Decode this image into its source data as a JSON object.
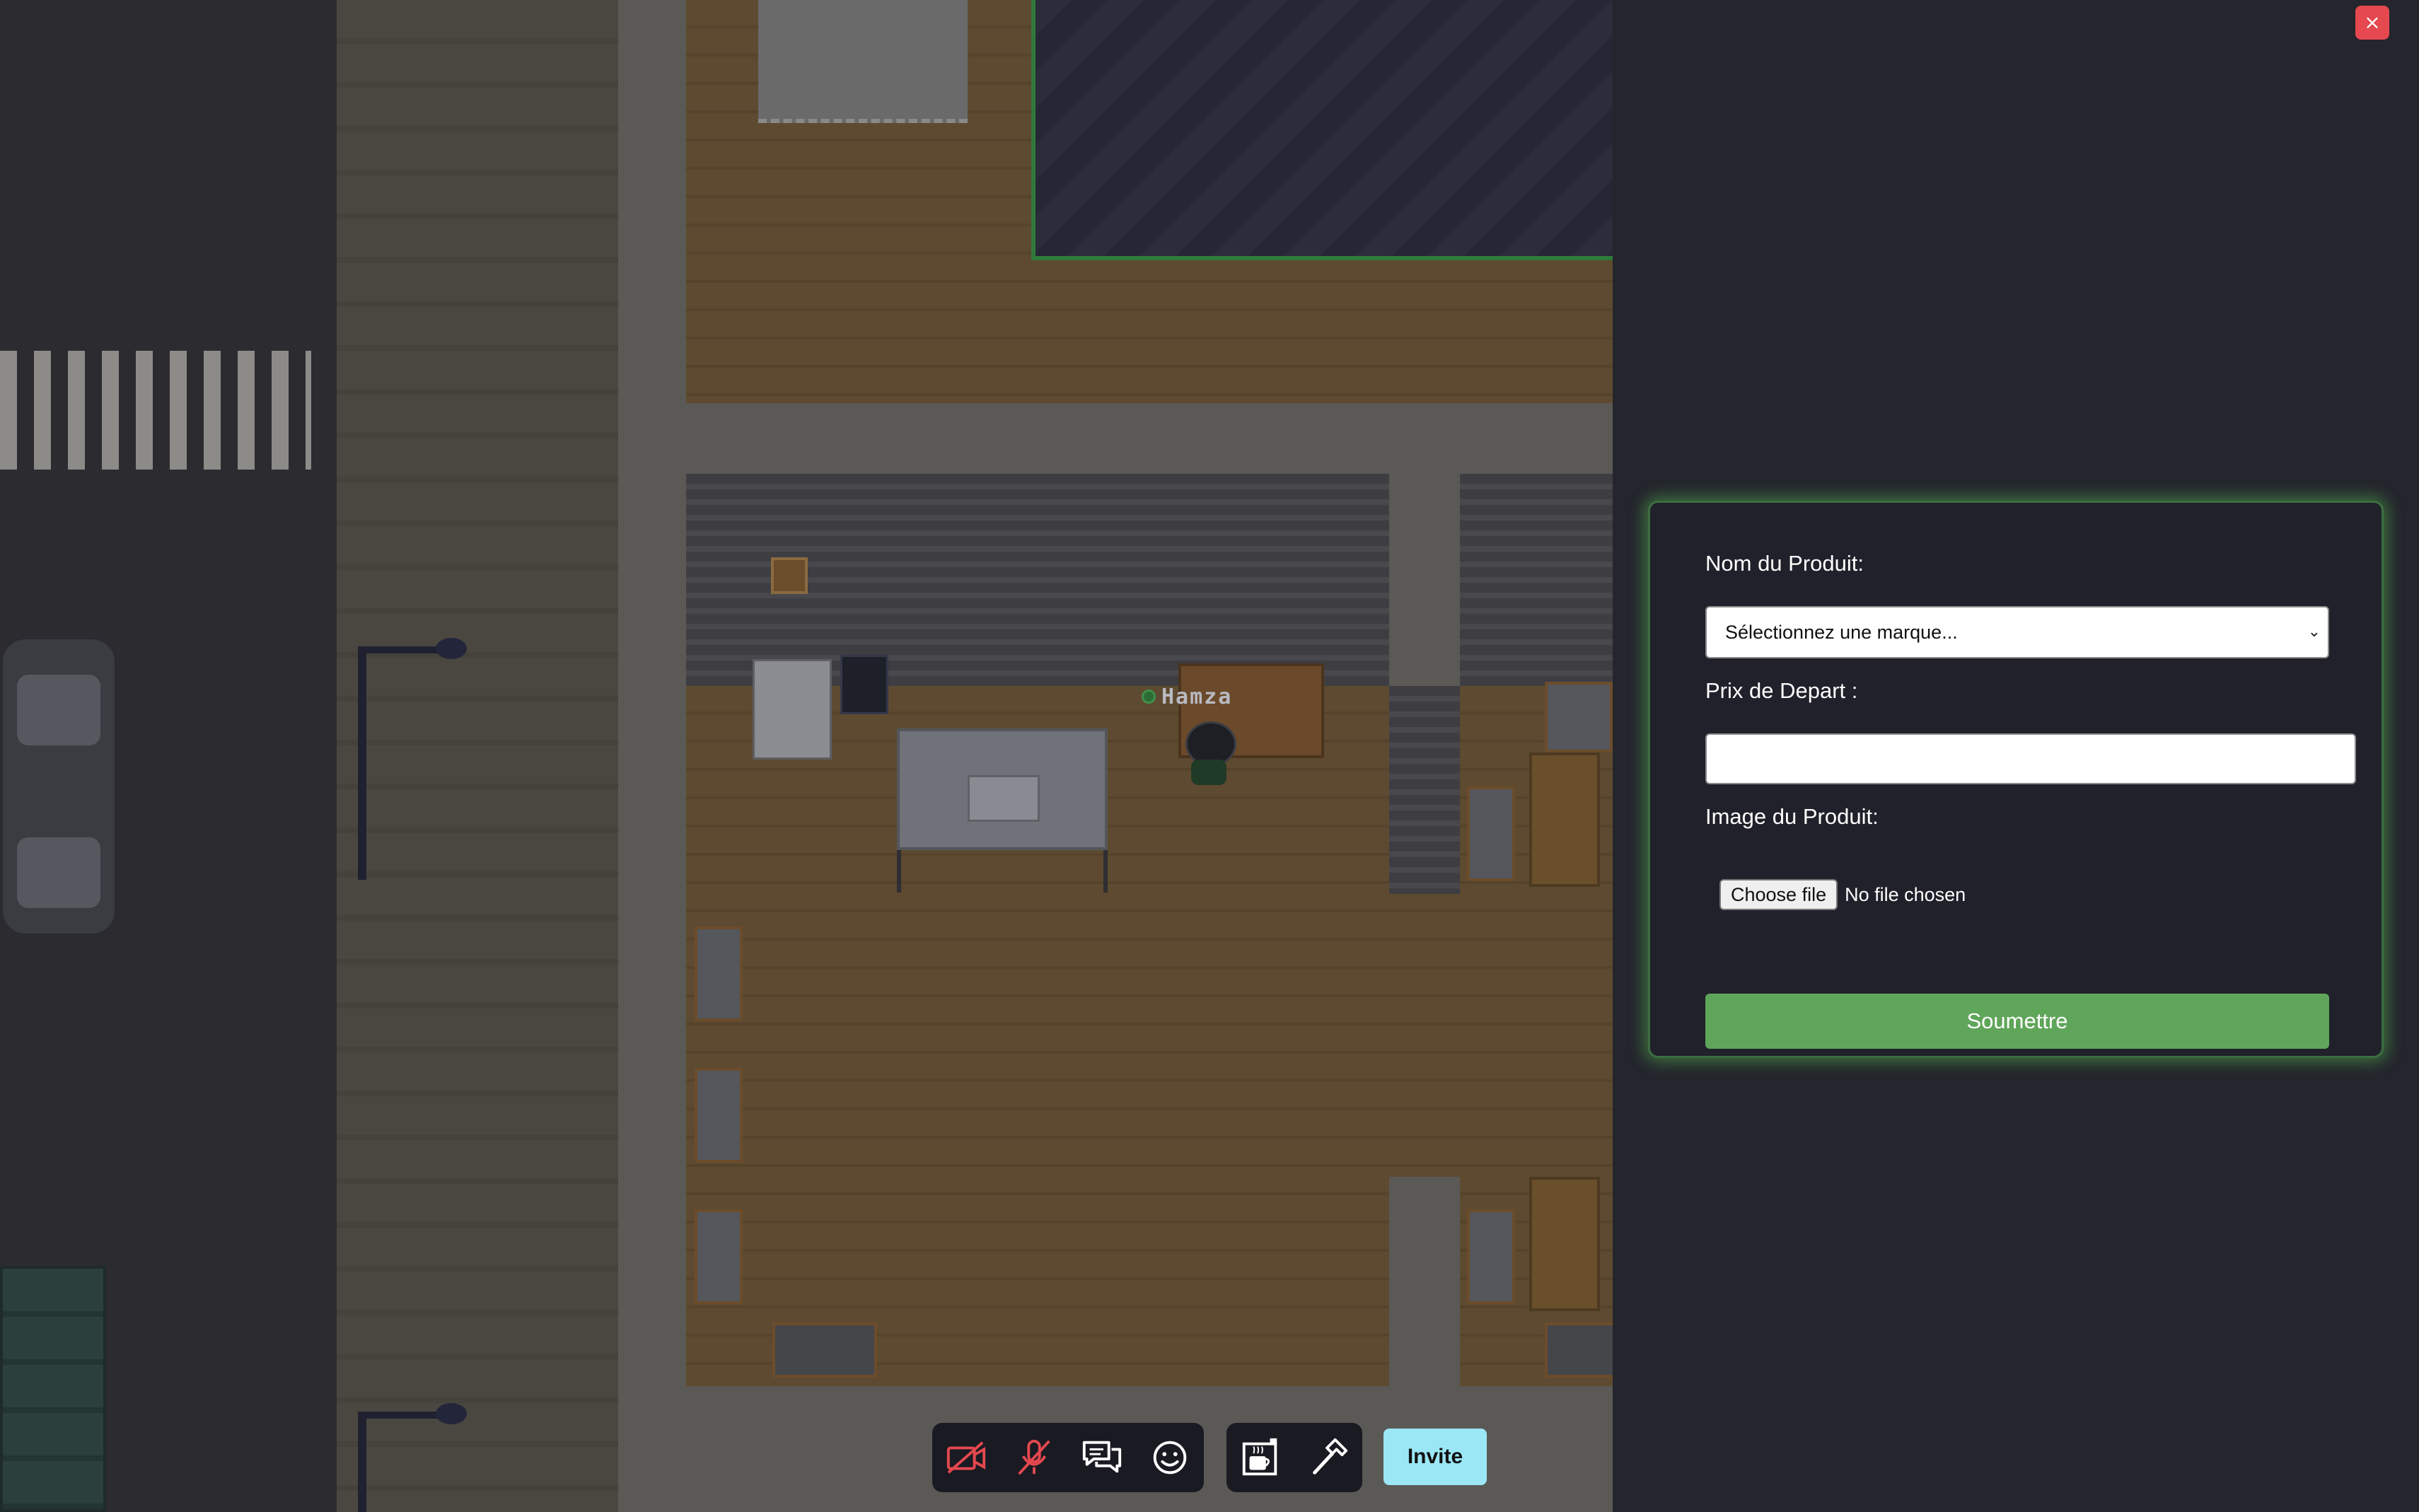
{
  "game_view": {
    "player_name": "Hamza",
    "player_status_color": "#3e8f49"
  },
  "modal": {
    "close_label": "×",
    "form": {
      "product_name_label": "Nom du Produit:",
      "brand_select_value": "Sélectionnez une marque...",
      "start_price_label": "Prix de Depart :",
      "start_price_value": "",
      "image_label": "Image du Produit:",
      "file_button_label": "Choose file",
      "file_status": "No file chosen",
      "submit_label": "Soumettre"
    },
    "accent_color": "#5fa55a"
  },
  "toolbar": {
    "media_controls": [
      {
        "icon": "camera-off-icon",
        "color": "#e5484f"
      },
      {
        "icon": "microphone-off-icon",
        "color": "#e5484f"
      },
      {
        "icon": "chat-bubbles-icon",
        "color": "#ffffff"
      },
      {
        "icon": "emoji-icon",
        "color": "#ffffff"
      }
    ],
    "tool_controls": [
      {
        "icon": "coffee-break-icon",
        "color": "#ffffff"
      },
      {
        "icon": "hammer-build-icon",
        "color": "#ffffff"
      }
    ],
    "invite_label": "Invite",
    "invite_color": "#9be7f6"
  }
}
